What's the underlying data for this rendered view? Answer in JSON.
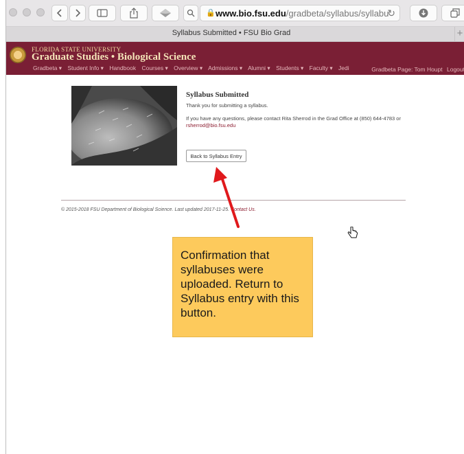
{
  "browser": {
    "url_host": "www.bio.fsu.edu",
    "url_path": "/gradbeta/syllabus/syllabu",
    "tab_title": "Syllabus Submitted • FSU Bio Grad"
  },
  "site": {
    "university": "FLORIDA STATE UNIVERSITY",
    "title": "Graduate Studies • Biological Science",
    "nav_items": [
      "Gradbeta ▾",
      "Student Info ▾",
      "Handbook",
      "Courses ▾",
      "Overview ▾",
      "Admissions ▾",
      "Alumni ▾",
      "Students ▾",
      "Faculty ▾",
      "Jedi"
    ],
    "nav_right": {
      "page_user": "Gradbeta Page: Tom Houpt",
      "logout": "Logout"
    }
  },
  "main": {
    "heading": "Syllabus Submitted",
    "thanks": "Thank you for submitting a syllabus.",
    "contact_text": "If you have any questions, please contact Rita Sherrod in the Grad Office at (850) 644-4783 or",
    "contact_email": "rsherrod@bio.fsu.edu",
    "back_button": "Back to Syllabus Entry"
  },
  "footer": {
    "text": "© 2015-2018 FSU Department of Biological Science. Last updated 2017-11-25.",
    "contact": "Contact Us."
  },
  "annotation": {
    "text": "Confirmation that syllabuses were uploaded. Return to Syllabus entry with this button."
  },
  "colors": {
    "header_bg": "#7a1f35",
    "accent_link": "#8b1b2e",
    "callout_bg": "#fdca5c",
    "arrow": "#e0191c"
  },
  "icons": [
    "close-dot",
    "minimize-dot",
    "zoom-dot",
    "back-icon",
    "forward-icon",
    "sidebar-icon",
    "share-icon",
    "extension-icon",
    "search-icon",
    "lock-icon",
    "reload-icon",
    "download-icon",
    "tabs-icon",
    "pointer-cursor-icon"
  ]
}
